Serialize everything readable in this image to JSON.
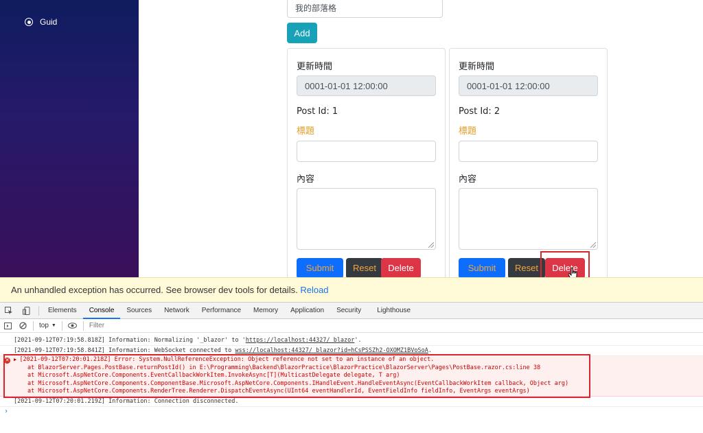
{
  "sidebar": {
    "items": [
      {
        "label": "Guid"
      }
    ]
  },
  "blog_input": {
    "value": "我的部落格"
  },
  "add_button": {
    "label": "Add"
  },
  "cards": [
    {
      "updated_label": "更新時間",
      "updated_value": "0001-01-01 12:00:00",
      "post_id": "Post Id: 1",
      "title_label": "標題",
      "content_label": "內容",
      "submit_label": "Submit",
      "reset_label": "Reset",
      "delete_label": "Delete"
    },
    {
      "updated_label": "更新時間",
      "updated_value": "0001-01-01 12:00:00",
      "post_id": "Post Id: 2",
      "title_label": "標題",
      "content_label": "內容",
      "submit_label": "Submit",
      "reset_label": "Reset",
      "delete_label": "Delete"
    }
  ],
  "error_banner": {
    "message": "An unhandled exception has occurred. See browser dev tools for details.",
    "reload_label": "Reload"
  },
  "devtools": {
    "tabs": [
      "Elements",
      "Console",
      "Sources",
      "Network",
      "Performance",
      "Memory",
      "Application",
      "Security",
      "Lighthouse"
    ],
    "active_tab": "Console",
    "context": "top",
    "filter_placeholder": "Filter",
    "logs": {
      "line1_prefix": "[2021-09-12T07:19:58.818Z] Information: Normalizing '_blazor' to '",
      "line1_link": "https://localhost:44327/_blazor",
      "line1_suffix": "'.",
      "line2_prefix": "[2021-09-12T07:19:58.841Z] Information: WebSocket connected to ",
      "line2_link": "wss://localhost:44327/_blazor?id=hCsPSSZh2-OXOMZ1BVoSoA",
      "line2_suffix": ".",
      "error_lines": [
        "[2021-09-12T07:20:01.218Z] Error: System.NullReferenceException: Object reference not set to an instance of an object.",
        "at BlazorServer.Pages.PostBase.returnPostId() in E:\\Programming\\Backend\\BlazorPractice\\BlazorPractice\\BlazorServer\\Pages\\PostBase.razor.cs:line 38",
        "at Microsoft.AspNetCore.Components.EventCallbackWorkItem.InvokeAsync[T](MulticastDelegate delegate, T arg)",
        "at Microsoft.AspNetCore.Components.ComponentBase.Microsoft.AspNetCore.Components.IHandleEvent.HandleEventAsync(EventCallbackWorkItem callback, Object arg)",
        "at Microsoft.AspNetCore.Components.RenderTree.Renderer.DispatchEventAsync(UInt64 eventHandlerId, EventFieldInfo fieldInfo, EventArgs eventArgs)"
      ],
      "line_last": "[2021-09-12T07:20:01.219Z] Information: Connection disconnected."
    },
    "prompt": "›"
  },
  "colors": {
    "sidebar_top": "#0f1c5e",
    "sidebar_bottom": "#3a0f5a",
    "add": "#17a2b8",
    "submit": "#0d6efd",
    "reset": "#343a40",
    "delete": "#dc3545",
    "highlight": "#d9262c"
  }
}
